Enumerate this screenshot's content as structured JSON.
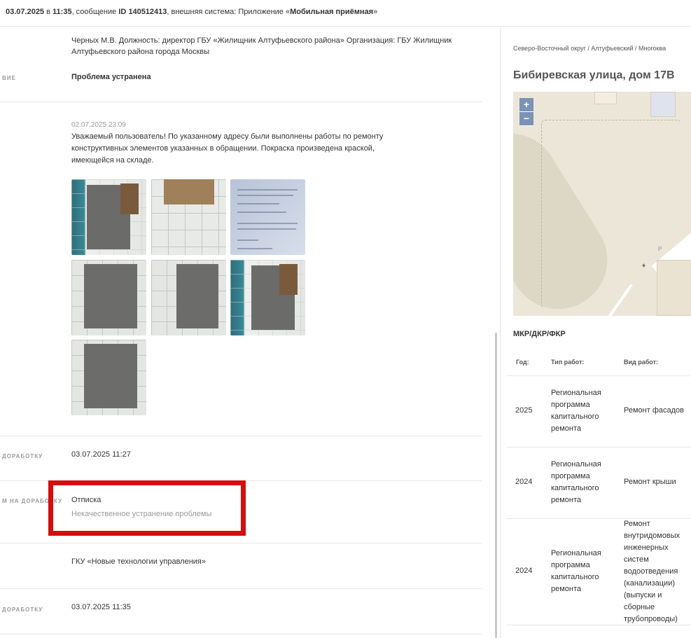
{
  "header": {
    "date": "03.07.2025",
    "at": "в",
    "time": "11:35",
    "msg_prefix": ", сообщение",
    "msg_id": "ID 140512413",
    "system_prefix": ", внешняя система: Приложение «",
    "system_name": "Мобильная приёмная",
    "system_suffix": "»"
  },
  "left": {
    "responsible": "Черных М.В. Должность: директор ГБУ «Жилищник Алтуфьевского района» Организация: ГБУ Жилищник Алтуфьевского района города Москвы",
    "status_label": "ВИЕ",
    "status": "Проблема устранена",
    "reply_date": "02.07.2025 23:09",
    "reply_text": "Уважаемый пользователь! По указанному адресу были выполнены работы по ремонту конструктивных элементов указанных в обращении. Покраска произведена краской, имеющейся на складе.",
    "rework_label": "ДОРАБОТКУ",
    "rework_date": "03.07.2025 11:27",
    "reason_label": "М НА ДОРАБОТКУ",
    "reason_title": "Отписка",
    "reason_detail": "Некачественное устранение проблемы",
    "org": "ГКУ «Новые технологии управления»",
    "rework2_label": "ДОРАБОТКУ",
    "rework2_date": "03.07.2025 11:35"
  },
  "right": {
    "breadcrumb": "Северо-Восточный округ / Алтуфьевский / Многоква",
    "address": "Бибиревская улица, дом 17В",
    "zoom_in": "+",
    "zoom_out": "−",
    "section_title": "МКР/ДКР/ФКР",
    "columns": [
      "Год:",
      "Тип работ:",
      "Вид работ:"
    ],
    "rows": [
      {
        "year": "2025",
        "type": "Региональная программа капитального ремонта",
        "kind": "Ремонт фасадов"
      },
      {
        "year": "2024",
        "type": "Региональная программа капитального ремонта",
        "kind": "Ремонт крыши"
      },
      {
        "year": "2024",
        "type": "Региональная программа капитального ремонта",
        "kind": "Ремонт внутридомовых инженерных систем водоотведения (канализации) (выпуски и сборные трубопроводы)"
      }
    ]
  }
}
